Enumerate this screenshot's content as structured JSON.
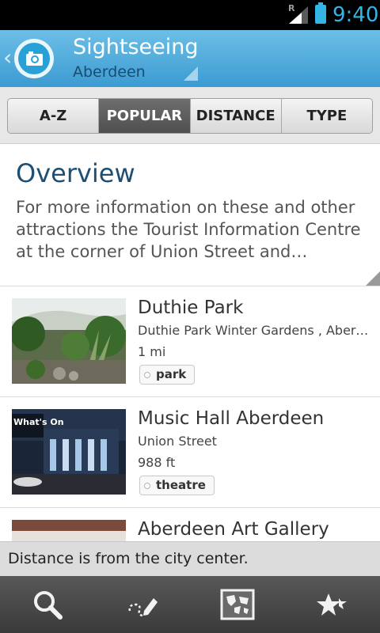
{
  "status_bar": {
    "time": "9:40",
    "roaming": "R"
  },
  "header": {
    "title": "Sightseeing",
    "subtitle": "Aberdeen",
    "back_glyph": "‹"
  },
  "tabs": [
    {
      "label": "A-Z",
      "active": false
    },
    {
      "label": "POPULAR",
      "active": true
    },
    {
      "label": "DISTANCE",
      "active": false
    },
    {
      "label": "TYPE",
      "active": false
    }
  ],
  "overview": {
    "heading": "Overview",
    "text": "For more information on these and other attractions the Tourist Information Centre at the corner of Union Street and…"
  },
  "items": [
    {
      "title": "Duthie Park",
      "subtitle": "Duthie Park Winter Gardens , Aberd…",
      "distance": "1 mi",
      "tag": "park",
      "thumb_icon": "garden-photo"
    },
    {
      "title": "Music Hall Aberdeen",
      "subtitle": "Union Street",
      "distance": "988 ft",
      "tag": "theatre",
      "thumb_icon": "music-hall-photo",
      "thumb_text": "What's On"
    },
    {
      "title": "Aberdeen Art Gallery",
      "subtitle": "",
      "distance": "",
      "tag": "",
      "thumb_icon": "gallery-photo"
    }
  ],
  "notice": "Distance is from the city center.",
  "toolbar": [
    {
      "icon": "search-icon"
    },
    {
      "icon": "route-icon"
    },
    {
      "icon": "map-icon"
    },
    {
      "icon": "favorites-icon"
    }
  ],
  "colors": {
    "accent": "#33b5e5",
    "header_top": "#6cbfe6",
    "header_bottom": "#3c9bd2",
    "heading": "#1e4f72"
  }
}
